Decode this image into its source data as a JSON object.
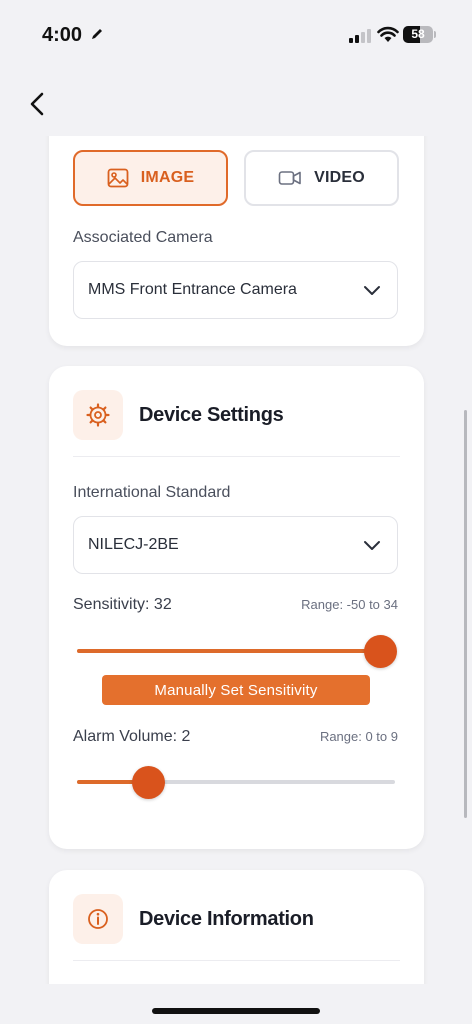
{
  "status_bar": {
    "time": "4:00",
    "battery_level": "58"
  },
  "media_type": {
    "options": [
      {
        "label": "IMAGE",
        "icon": "image-icon",
        "selected": true
      },
      {
        "label": "VIDEO",
        "icon": "video-camera-icon",
        "selected": false
      }
    ]
  },
  "associated_camera": {
    "label": "Associated Camera",
    "value": "MMS Front Entrance Camera"
  },
  "device_settings": {
    "title": "Device Settings",
    "icon": "gear-icon",
    "international_standard": {
      "label": "International Standard",
      "value": "NILECJ-2BE"
    },
    "sensitivity": {
      "label": "Sensitivity: 32",
      "range_text": "Range: -50 to 34",
      "value": 32,
      "min": -50,
      "max": 34
    },
    "manual_button_label": "Manually Set Sensitivity",
    "alarm_volume": {
      "label": "Alarm Volume: 2",
      "range_text": "Range: 0 to 9",
      "value": 2,
      "min": 0,
      "max": 9
    }
  },
  "device_information": {
    "title": "Device Information",
    "icon": "info-icon"
  },
  "colors": {
    "accent": "#e06a2a",
    "accent_light": "#fdf0e9",
    "background": "#f2f2f5"
  }
}
